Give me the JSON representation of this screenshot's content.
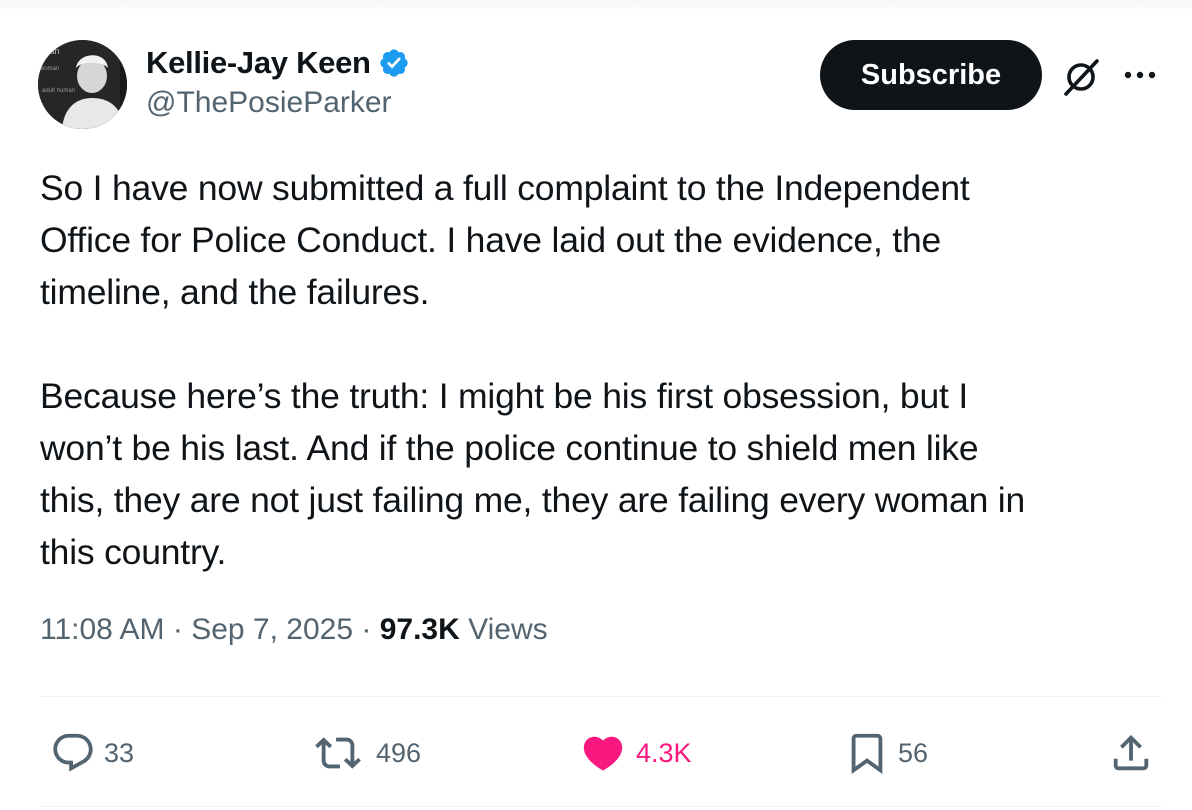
{
  "author": {
    "display_name": "Kellie-Jay Keen",
    "handle": "@ThePosieParker",
    "verified": true,
    "avatar_icon": "profile-photo",
    "avatar_background_text": [
      "man",
      "woman",
      "adult human"
    ]
  },
  "header": {
    "subscribe_label": "Subscribe",
    "grok_icon": "grok-icon",
    "more_icon": "more-icon"
  },
  "tweet": {
    "text": "So I have now submitted a full complaint to the Independent\nOffice for Police Conduct. I have laid out the evidence, the\ntimeline, and the failures.\n\nBecause here’s the truth: I might be his first obsession, but I\nwon’t be his last. And if the police continue to shield men like\nthis, they are not just failing me, they are failing every woman in\nthis country.",
    "time": "11:08 AM",
    "separator": "·",
    "date": "Sep 7, 2025",
    "views_count": "97.3K",
    "views_label": "Views"
  },
  "actions": {
    "replies": {
      "icon": "reply-icon",
      "count": "33"
    },
    "reposts": {
      "icon": "repost-icon",
      "count": "496"
    },
    "likes": {
      "icon": "heart-icon",
      "count": "4.3K",
      "liked": true,
      "color": "#f91880"
    },
    "bookmarks": {
      "icon": "bookmark-icon",
      "count": "56"
    },
    "share": {
      "icon": "share-icon"
    }
  },
  "colors": {
    "text_primary": "#0f1419",
    "text_secondary": "#536471",
    "verified_blue": "#1d9bf0",
    "like_pink": "#f91880",
    "subscribe_bg": "#0f1419"
  }
}
